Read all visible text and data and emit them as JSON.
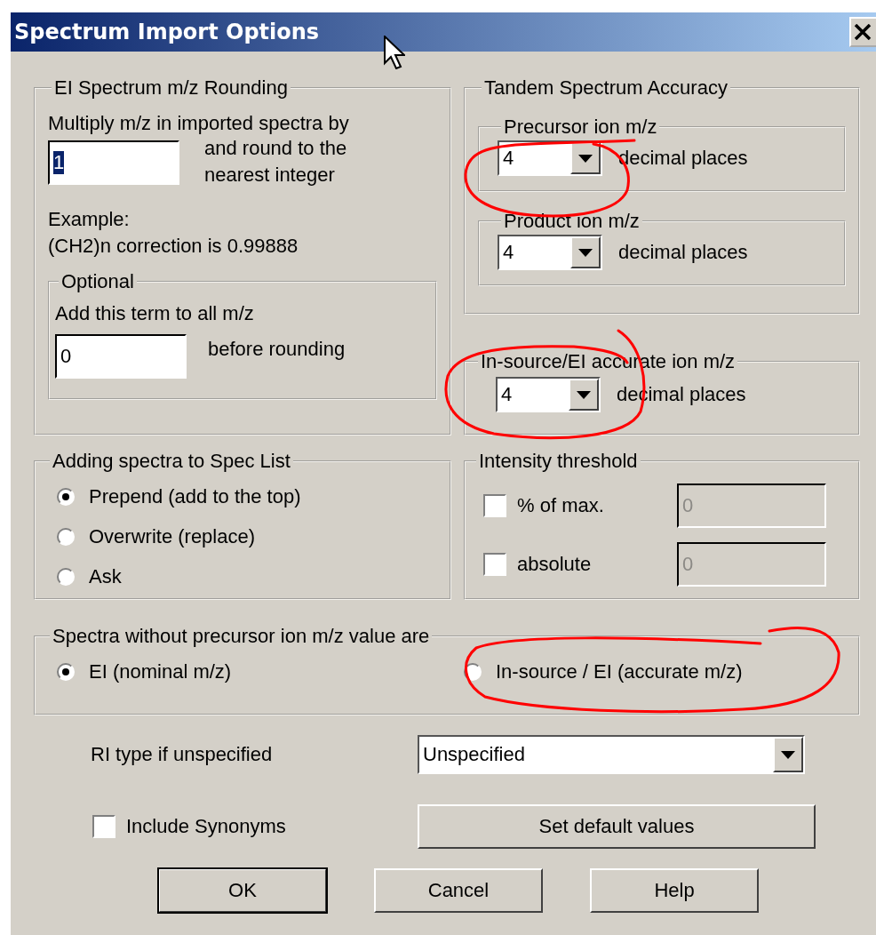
{
  "window": {
    "title": "Spectrum Import Options"
  },
  "ei_rounding": {
    "label": "EI Spectrum m/z Rounding",
    "prompt": "Multiply m/z in imported spectra by",
    "multiplier": {
      "value": "1",
      "text_selected": true
    },
    "after_field": "and round to the nearest integer",
    "example_label": "Example:",
    "example_text": "(CH2)n correction is 0.99888",
    "optional": {
      "label": "Optional",
      "prompt": "Add this term to all m/z",
      "value": "0",
      "after_field": "before rounding"
    }
  },
  "tandem": {
    "label": "Tandem Spectrum Accuracy",
    "groups": [
      {
        "label": "Precursor ion m/z",
        "value": "4",
        "unit": "decimal places"
      },
      {
        "label": "Product ion m/z",
        "value": "4",
        "unit": "decimal places"
      }
    ]
  },
  "in_source": {
    "label": "In-source/EI accurate ion m/z",
    "value": "4",
    "unit": "decimal places"
  },
  "adding": {
    "label": "Adding spectra to Spec List",
    "options": [
      {
        "label": "Prepend (add to the top)",
        "selected": true
      },
      {
        "label": "Overwrite (replace)",
        "selected": false
      },
      {
        "label": "Ask",
        "selected": false
      }
    ]
  },
  "intensity": {
    "label": "Intensity threshold",
    "rows": [
      {
        "label": "% of max.",
        "checked": false,
        "value": "0",
        "disabled": true
      },
      {
        "label": "absolute",
        "checked": false,
        "value": "0",
        "disabled": true
      }
    ]
  },
  "spectra_without": {
    "label": "Spectra without precursor ion m/z value are",
    "options": [
      {
        "label": "EI (nominal m/z)",
        "selected": true
      },
      {
        "label": "In-source / EI (accurate m/z)",
        "selected": false
      }
    ]
  },
  "ri_type": {
    "label": "RI type if unspecified",
    "value": "Unspecified"
  },
  "include_synonyms": {
    "label": "Include Synonyms",
    "checked": false
  },
  "set_defaults": "Set default values",
  "buttons": [
    {
      "label": "OK",
      "default": true
    },
    {
      "label": "Cancel",
      "default": false
    },
    {
      "label": "Help",
      "default": false
    }
  ]
}
